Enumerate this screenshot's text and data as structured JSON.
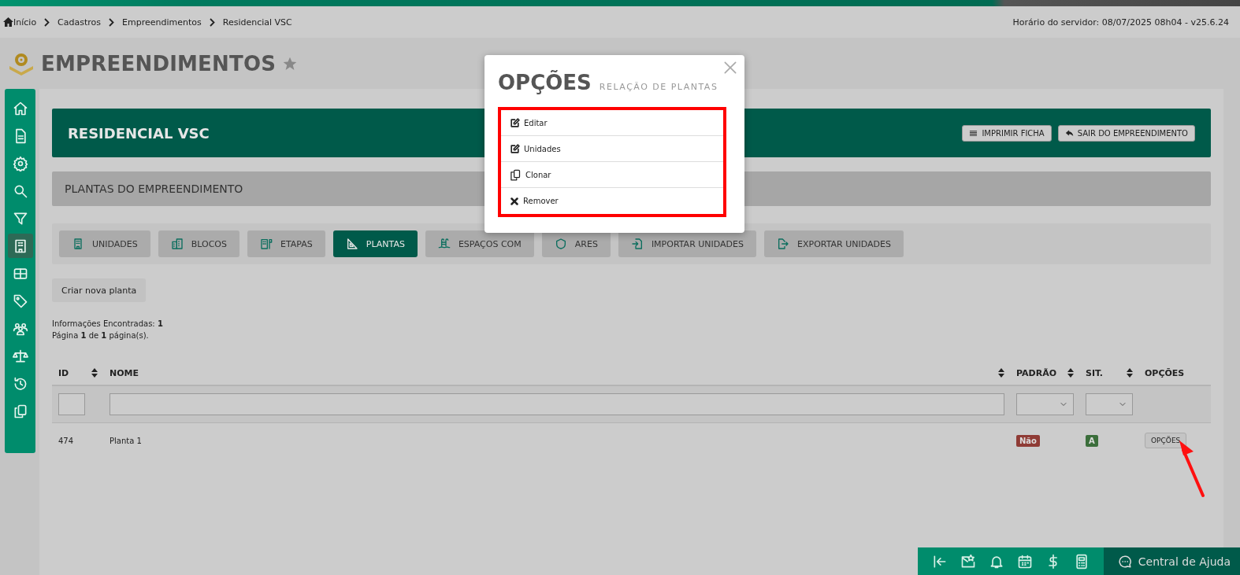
{
  "top_bar": {
    "breadcrumbs": [
      {
        "label": "Início",
        "kind": "home"
      },
      {
        "label": "Cadastros",
        "kind": "plain"
      },
      {
        "label": "Empreendimentos",
        "kind": "plain"
      },
      {
        "label": "Residencial VSC",
        "kind": "plain"
      }
    ],
    "server_time": "Horário do servidor: 08/07/2025 08h04 - v25.6.24"
  },
  "page": {
    "title": "EMPREENDIMENTOS",
    "favorite": false
  },
  "sidebar": {
    "items": [
      {
        "kind": "home",
        "selected": false
      },
      {
        "kind": "document",
        "selected": false
      },
      {
        "kind": "gear",
        "selected": false
      },
      {
        "kind": "search",
        "selected": false
      },
      {
        "kind": "filter",
        "selected": false
      },
      {
        "kind": "building",
        "selected": true
      },
      {
        "kind": "table",
        "selected": false
      },
      {
        "kind": "tag",
        "selected": false
      },
      {
        "kind": "people",
        "selected": false
      },
      {
        "kind": "scale",
        "selected": false
      },
      {
        "kind": "history",
        "selected": false
      },
      {
        "kind": "copy",
        "selected": false
      }
    ]
  },
  "project": {
    "title": "RESIDENCIAL VSC",
    "buttons": [
      {
        "label": "IMPRIMIR FICHA",
        "kind": "print"
      },
      {
        "label": "SAIR DO EMPREENDIMENTO",
        "kind": "exit"
      }
    ]
  },
  "section": {
    "title": "PLANTAS DO EMPREENDIMENTO"
  },
  "tabs": [
    {
      "label": "UNIDADES",
      "kind": "building",
      "selected": false
    },
    {
      "label": "BLOCOS",
      "kind": "blocks",
      "selected": false
    },
    {
      "label": "ETAPAS",
      "kind": "flag",
      "selected": false
    },
    {
      "label": "PLANTAS",
      "kind": "square",
      "selected": true
    },
    {
      "label": "ESPAÇOS COM",
      "kind": "pool",
      "selected": false
    },
    {
      "label": "ARES",
      "kind": "shield",
      "selected": false
    },
    {
      "label": "IMPORTAR UNIDADES",
      "kind": "import",
      "selected": false
    },
    {
      "label": "EXPORTAR UNIDADES",
      "kind": "export",
      "selected": false
    }
  ],
  "create_button": "Criar nova planta",
  "info": {
    "found": "Informações Encontradas: **1**",
    "pages": "Página **1** de **1** página(s)."
  },
  "table": {
    "columns": [
      {
        "label": "ID",
        "sortable": true
      },
      {
        "label": "NOME",
        "sortable": true
      },
      {
        "label": "PADRÃO",
        "sortable": true
      },
      {
        "label": "SIT.",
        "sortable": true
      },
      {
        "label": "OPÇÕES",
        "sortable": false
      }
    ],
    "rows": [
      {
        "id": "474",
        "name": "Planta 1",
        "default": {
          "label": "Não",
          "color": "#8f3b35"
        },
        "status": {
          "label": "A",
          "color": "#3b6e3b"
        },
        "options": "OPÇÕES"
      }
    ]
  },
  "toolbar": {
    "items": [
      {
        "kind": "collapse"
      },
      {
        "kind": "mail"
      },
      {
        "kind": "bell"
      },
      {
        "kind": "calendar"
      },
      {
        "kind": "dollar"
      },
      {
        "kind": "calculator"
      }
    ],
    "help": "Central de Ajuda"
  },
  "modal": {
    "title": "OPÇÕES",
    "subtitle": "RELAÇÃO DE PLANTAS",
    "items": [
      {
        "label": "Editar",
        "kind": "edit"
      },
      {
        "label": "Unidades",
        "kind": "edit"
      },
      {
        "label": "Clonar",
        "kind": "clone"
      },
      {
        "label": "Remover",
        "kind": "remove"
      }
    ]
  }
}
